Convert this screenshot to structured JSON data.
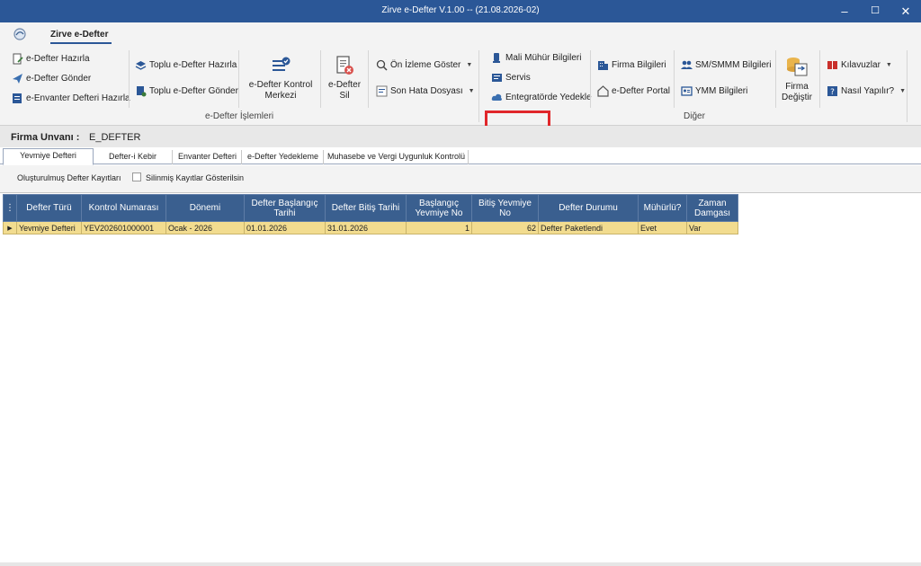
{
  "window": {
    "title": "Zirve e-Defter V.1.00  -- (21.08.2026-02)",
    "minimize": "‒",
    "maximize": "☐",
    "close": "✕"
  },
  "ribbon_tab": "Zirve e-Defter",
  "ribbon": {
    "defter": {
      "hazirla": "e-Defter Hazırla",
      "gonder": "e-Defter Gönder",
      "envanter_hazirla": "e-Envanter Defteri Hazırla",
      "toplu_hazirla": "Toplu e-Defter Hazırla",
      "toplu_gonder": "Toplu e-Defter Gönder",
      "kontrol_merkezi_1": "e-Defter Kontrol",
      "kontrol_merkezi_2": "Merkezi",
      "sil_1": "e-Defter",
      "sil_2": "Sil",
      "on_izleme": "Ön İzleme Göster",
      "son_hata": "Son Hata Dosyası",
      "group_label": "e-Defter İşlemleri"
    },
    "diger": {
      "mali_muhur": "Mali Mühür Bilgileri",
      "servis": "Servis",
      "entegrator": "Entegratörde Yedekle",
      "firma_bilgileri": "Firma Bilgileri",
      "portal": "e-Defter Portal",
      "smmm": "SM/SMMM Bilgileri",
      "ymm": "YMM Bilgileri",
      "firma_degistir_1": "Firma",
      "firma_degistir_2": "Değiştir",
      "kilavuzlar": "Kılavuzlar",
      "nasil": "Nasıl Yapılır?",
      "group_label": "Diğer"
    }
  },
  "firma": {
    "label": "Firma Unvanı :",
    "value": "E_DEFTER"
  },
  "doc_tabs": [
    "Yevmiye Defteri",
    "Defter-i Kebir",
    "Envanter Defteri",
    "e-Defter Yedekleme",
    "Muhasebe ve Vergi Uygunluk Kontrolü"
  ],
  "options": {
    "label": "Oluşturulmuş Defter Kayıtları",
    "checkbox_label": "Silinmiş Kayıtlar Gösterilsin"
  },
  "grid": {
    "columns": [
      "Defter Türü",
      "Kontrol Numarası",
      "Dönemi",
      "Defter Başlangıç Tarihi",
      "Defter Bitiş Tarihi",
      "Başlangıç Yevmiye No",
      "Bitiş Yevmiye No",
      "Defter Durumu",
      "Mühürlü?",
      "Zaman Damgası"
    ],
    "rows": [
      [
        "Yevmiye Defteri",
        "YEV202601000001",
        "Ocak - 2026",
        "01.01.2026",
        "31.01.2026",
        "1",
        "62",
        "Defter Paketlendi",
        "Evet",
        "Var"
      ]
    ]
  }
}
